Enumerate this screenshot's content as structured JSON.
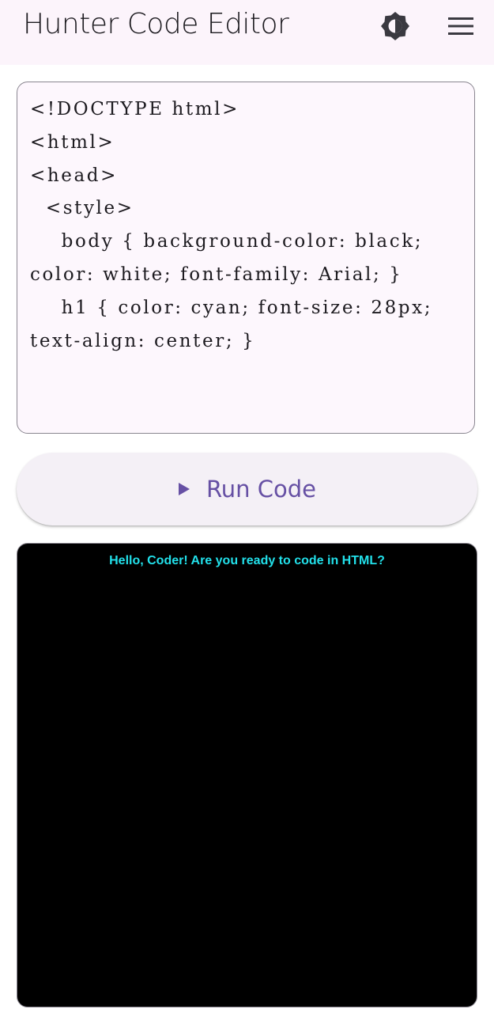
{
  "app_bar": {
    "title": "Hunter Code Editor",
    "theme_icon": "brightness-contrast-icon",
    "menu_icon": "hamburger-menu-icon",
    "background": "#fcf4fb"
  },
  "editor": {
    "code": "<!DOCTYPE html>\n<html>\n<head>\n  <style>\n    body { background-color: black; color: white; font-family: Arial; }\n    h1 { color: cyan; font-size: 28px; text-align: center; }"
  },
  "run_button": {
    "icon": "play-icon",
    "label": "Run Code",
    "accent": "#6650a4"
  },
  "preview": {
    "heading": "Hello, Coder! Are you ready to code in HTML?",
    "background": "#000000",
    "heading_color": "#22e0ea"
  }
}
